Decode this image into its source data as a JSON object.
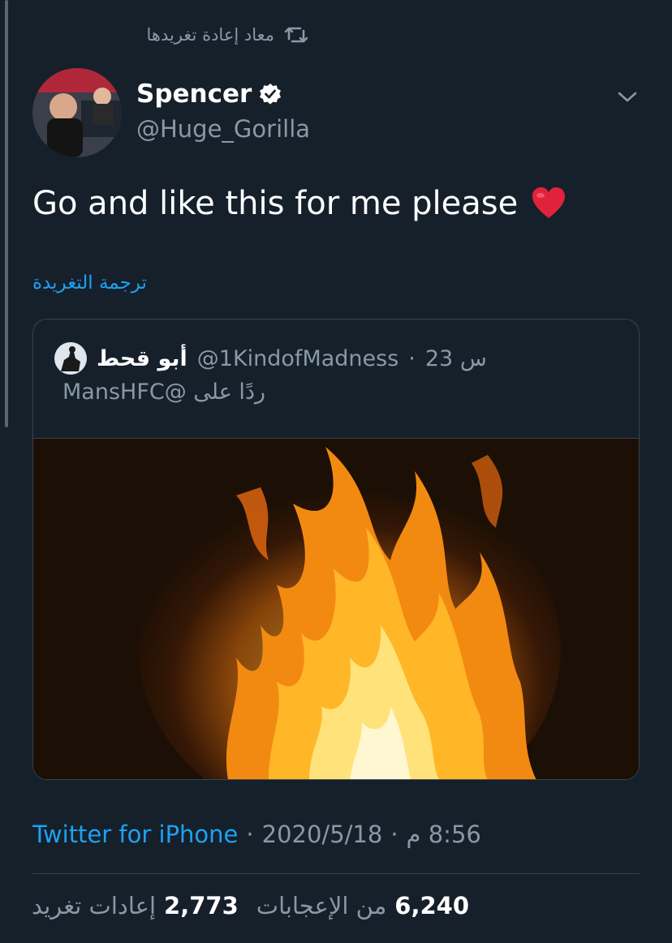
{
  "retweet_context": {
    "label": "معاد إعادة تغريدها",
    "icon": "retweet-icon"
  },
  "tweet": {
    "display_name": "Spencer",
    "handle": "@Huge_Gorilla",
    "verified_icon": "verified-badge-icon",
    "text": "Go and like this for me please",
    "emoji": "heart-emoji",
    "translate_label": "ترجمة التغريدة"
  },
  "quoted_tweet": {
    "display_name": "أبو قحط",
    "handle": "@1KindofMadness",
    "separator": "·",
    "time": "23 س",
    "reply_to": "ردًا على @MansHFC"
  },
  "meta": {
    "source": "Twitter for iPhone",
    "sep1": "·",
    "date": "2020/5/18",
    "sep2": "·",
    "time": "8:56 م"
  },
  "stats": {
    "retweets_count": "2,773",
    "retweets_label": "إعادات تغريد",
    "likes_count": "6,240",
    "likes_label": "من الإعجابات"
  },
  "colors": {
    "background": "#15202b",
    "accent": "#1da1f2",
    "muted": "#8899a6",
    "border": "#38444d"
  }
}
